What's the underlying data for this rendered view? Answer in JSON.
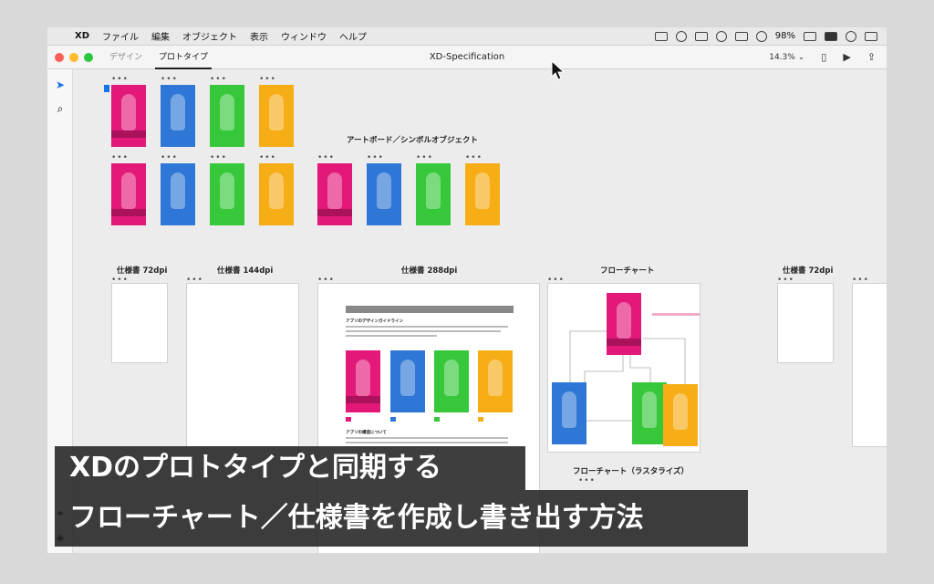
{
  "menubar": {
    "app": "XD",
    "items": [
      "ファイル",
      "編集",
      "オブジェクト",
      "表示",
      "ウィンドウ",
      "ヘルプ"
    ],
    "battery": "98%"
  },
  "window": {
    "tabs": [
      "デザイン",
      "プロトタイプ"
    ],
    "active_tab": "プロトタイプ",
    "title": "XD-Specification",
    "zoom": "14.3%"
  },
  "canvas": {
    "section_artboard_symbol": "アートボード／シンボルオブジェクト",
    "sheet_labels": {
      "spec72": "仕様書 72dpi",
      "spec144": "仕様書 144dpi",
      "spec288": "仕様書 288dpi",
      "flowchart": "フローチャート",
      "spec72b": "仕様書 72dpi",
      "flowchart_raster": "フローチャート（ラスタライズ）"
    },
    "spec_doc": {
      "heading": "アプリのデザインガイドライン",
      "sub_heading": "アプリの構造について"
    }
  },
  "caption": {
    "line1": "XDのプロトタイプと同期する",
    "line2": "フローチャート／仕様書を作成し書き出す方法"
  },
  "colors": {
    "pink": "#e3197a",
    "blue": "#2f77d6",
    "green": "#36c83a",
    "orange": "#f6ad16"
  }
}
